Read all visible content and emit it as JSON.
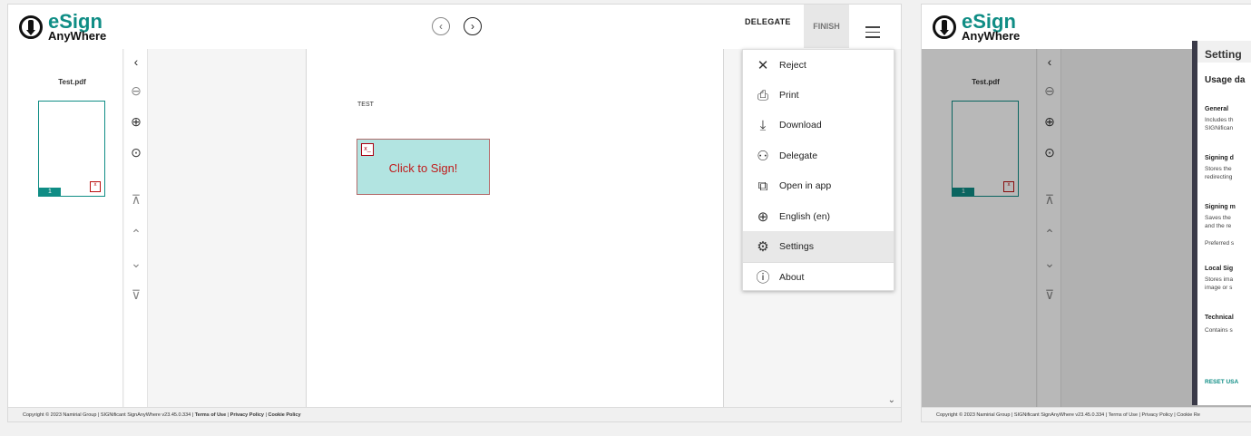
{
  "brand": {
    "primary": "eSign",
    "secondary": "AnyWhere",
    "accent": "#0f8d85"
  },
  "header": {
    "delegate": "DELEGATE",
    "finish": "FINISH"
  },
  "thumb": {
    "name": "Test.pdf",
    "page": "1"
  },
  "document": {
    "text": "TEST",
    "sign_label": "Click to Sign!",
    "sign_icon": "x_"
  },
  "menu": [
    {
      "label": "Reject",
      "icon": "close-icon",
      "glyph": "✕"
    },
    {
      "label": "Print",
      "icon": "printer-icon",
      "glyph": "⎙"
    },
    {
      "label": "Download",
      "icon": "download-icon",
      "glyph": "⤓"
    },
    {
      "label": "Delegate",
      "icon": "delegate-user-icon",
      "glyph": "⚇"
    },
    {
      "label": "Open in app",
      "icon": "open-external-icon",
      "glyph": "⧉"
    },
    {
      "label": "English (en)",
      "icon": "globe-icon",
      "glyph": "⊕"
    },
    {
      "label": "Settings",
      "icon": "gear-icon",
      "glyph": "⚙"
    },
    {
      "label": "About",
      "icon": "info-icon",
      "glyph": "ⓘ"
    }
  ],
  "footer": {
    "copyright": "Copyright © 2023 Namirial Group | SIGNificant SignAnyWhere v23.45.0.334 | ",
    "terms": "Terms of Use",
    "privacy": "Privacy Policy",
    "cookie": "Cookie Policy",
    "sep": " | "
  },
  "settings": {
    "title": "Setting",
    "subtitle": "Usage da",
    "sections": [
      {
        "heading": "General",
        "text1": "Includes th",
        "text2": "SIGNifican"
      },
      {
        "heading": "Signing d",
        "text1": "Stores the",
        "text2": "redirecting"
      },
      {
        "heading": "Signing m",
        "text1": "Saves the",
        "text2": "and the re",
        "text3": "Preferred s"
      },
      {
        "heading": "Local Sig",
        "text1": "Stores ima",
        "text2": "image or s"
      },
      {
        "heading": "Technical",
        "text1": "Contains s"
      }
    ],
    "reset": "RESET USA"
  },
  "footer_right": "Copyright © 2023 Namirial Group | SIGNificant SignAnyWhere v23.45.0.334 | Terms of Use | Privacy Policy | Cookie Re"
}
